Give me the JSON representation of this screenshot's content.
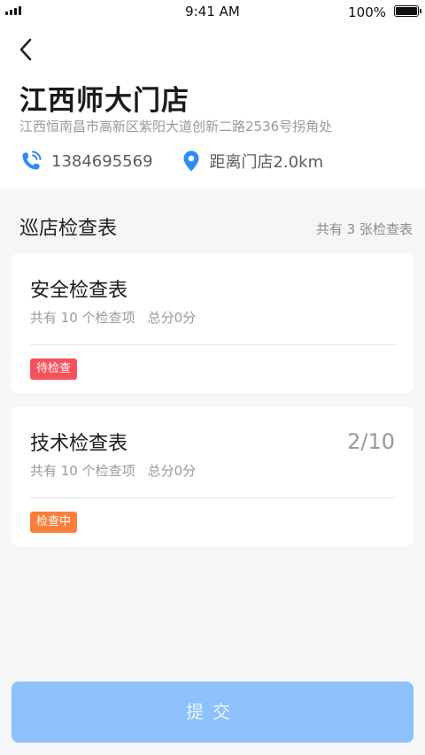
{
  "status_bar": {
    "time": "9:41 AM",
    "battery": "100%"
  },
  "store": {
    "name": "江西师大门店",
    "address": "江西恒南昌市高新区紫阳大道创新二路2536号拐角处",
    "phone": "1384695569",
    "distance": "距离门店2.0km"
  },
  "icons": {
    "back": "chevron-left-icon",
    "phone": "phone-icon",
    "location": "location-pin-icon"
  },
  "section": {
    "title": "巡店检查表",
    "count_text": "共有 3 张检查表"
  },
  "checklists": [
    {
      "title": "安全检查表",
      "items_text": "共有 10 个检查项",
      "score_text": "总分0分",
      "status": "待检查",
      "status_color": "#f5525b",
      "progress": ""
    },
    {
      "title": "技术检查表",
      "items_text": "共有 10 个检查项",
      "score_text": "总分0分",
      "status": "检查中",
      "status_color": "#fb7f3b",
      "progress": "2/10"
    }
  ],
  "submit_label": "提交",
  "colors": {
    "accent": "#2f8cf6",
    "submit_bg": "#8cc1fb"
  }
}
